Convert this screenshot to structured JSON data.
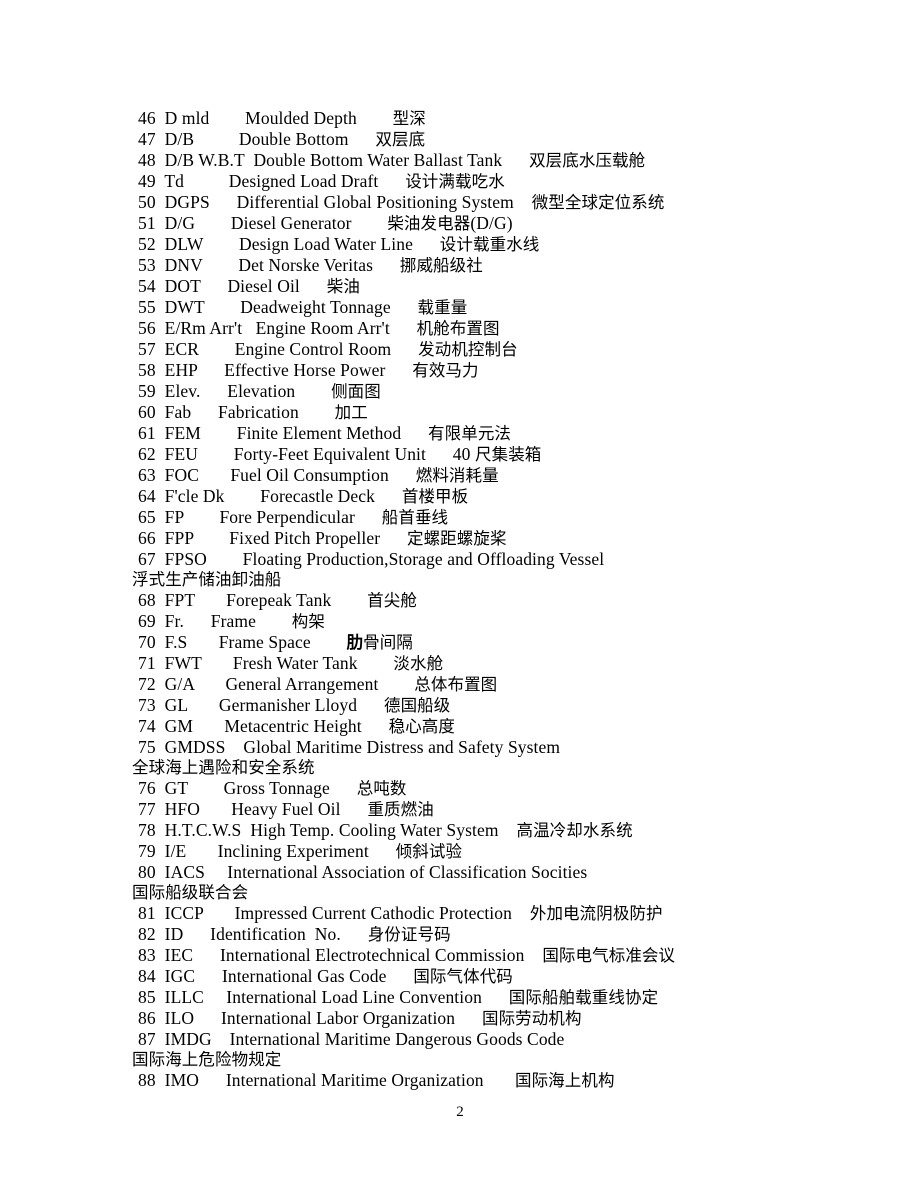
{
  "document": {
    "page_number": "2"
  },
  "glossary": {
    "entries": [
      {
        "num": "46",
        "line": "46  D mld        Moulded Depth        型深"
      },
      {
        "num": "47",
        "line": "47  D/B          Double Bottom      双层底"
      },
      {
        "num": "48",
        "line": "48  D/B W.B.T  Double Bottom Water Ballast Tank      双层底水压载舱"
      },
      {
        "num": "49",
        "line": "49  Td          Designed Load Draft      设计满载吃水"
      },
      {
        "num": "50",
        "line": "50  DGPS      Differential Global Positioning System    微型全球定位系统"
      },
      {
        "num": "51",
        "line": "51  D/G        Diesel Generator        柴油发电器(D/G)"
      },
      {
        "num": "52",
        "line": "52  DLW        Design Load Water Line      设计载重水线"
      },
      {
        "num": "53",
        "line": "53  DNV        Det Norske Veritas      挪威船级社"
      },
      {
        "num": "54",
        "line": "54  DOT      Diesel Oil      柴油"
      },
      {
        "num": "55",
        "line": "55  DWT        Deadweight Tonnage      载重量"
      },
      {
        "num": "56",
        "line": "56  E/Rm Arr't   Engine Room Arr't      机舱布置图"
      },
      {
        "num": "57",
        "line": "57  ECR        Engine Control Room      发动机控制台"
      },
      {
        "num": "58",
        "line": "58  EHP      Effective Horse Power      有效马力"
      },
      {
        "num": "59",
        "line": "59  Elev.      Elevation        侧面图"
      },
      {
        "num": "60",
        "line": "60  Fab      Fabrication        加工"
      },
      {
        "num": "61",
        "line": "61  FEM        Finite Element Method      有限单元法"
      },
      {
        "num": "62",
        "line": "62  FEU        Forty-Feet Equivalent Unit      40 尺集装箱"
      },
      {
        "num": "63",
        "line": "63  FOC       Fuel Oil Consumption      燃料消耗量"
      },
      {
        "num": "64",
        "line": "64  F'cle Dk        Forecastle Deck      首楼甲板"
      },
      {
        "num": "65",
        "line": "65  FP        Fore Perpendicular      船首垂线"
      },
      {
        "num": "66",
        "line": "66  FPP        Fixed Pitch Propeller      定螺距螺旋桨"
      },
      {
        "num": "67",
        "line": "67  FPSO        Floating Production,Storage and Offloading Vessel"
      },
      {
        "num": "67c",
        "line": "浮式生产储油卸油船",
        "continuation": true
      },
      {
        "num": "68",
        "line": "68  FPT       Forepeak Tank        首尖舱"
      },
      {
        "num": "69",
        "line": "69  Fr.      Frame        构架"
      },
      {
        "num": "70",
        "line": "70  F.S       Frame Space        肋骨间隔",
        "bold_prefix": "肋"
      },
      {
        "num": "71",
        "line": "71  FWT       Fresh Water Tank        淡水舱"
      },
      {
        "num": "72",
        "line": "72  G/A       General Arrangement        总体布置图"
      },
      {
        "num": "73",
        "line": "73  GL       Germanisher Lloyd      德国船级"
      },
      {
        "num": "74",
        "line": "74  GM       Metacentric Height      稳心高度"
      },
      {
        "num": "75",
        "line": "75  GMDSS    Global Maritime Distress and Safety System"
      },
      {
        "num": "75c",
        "line": "全球海上遇险和安全系统",
        "continuation": true
      },
      {
        "num": "76",
        "line": "76  GT        Gross Tonnage      总吨数"
      },
      {
        "num": "77",
        "line": "77  HFO       Heavy Fuel Oil      重质燃油"
      },
      {
        "num": "78",
        "line": "78  H.T.C.W.S  High Temp. Cooling Water System    高温冷却水系统"
      },
      {
        "num": "79",
        "line": "79  I/E       Inclining Experiment      倾斜试验"
      },
      {
        "num": "80",
        "line": "80  IACS     International Association of Classification Socities"
      },
      {
        "num": "80c",
        "line": "国际船级联合会",
        "continuation": true
      },
      {
        "num": "81",
        "line": "81  ICCP       Impressed Current Cathodic Protection    外加电流阴极防护"
      },
      {
        "num": "82",
        "line": "82  ID      Identification  No.      身份证号码"
      },
      {
        "num": "83",
        "line": "83  IEC      International Electrotechnical Commission    国际电气标准会议"
      },
      {
        "num": "84",
        "line": "84  IGC      International Gas Code      国际气体代码"
      },
      {
        "num": "85",
        "line": "85  ILLC     International Load Line Convention      国际船舶载重线协定"
      },
      {
        "num": "86",
        "line": "86  ILO      International Labor Organization      国际劳动机构"
      },
      {
        "num": "87",
        "line": "87  IMDG    International Maritime Dangerous Goods Code"
      },
      {
        "num": "87c",
        "line": "国际海上危险物规定",
        "continuation": true
      },
      {
        "num": "88",
        "line": "88  IMO      International Maritime Organization       国际海上机构"
      }
    ]
  }
}
